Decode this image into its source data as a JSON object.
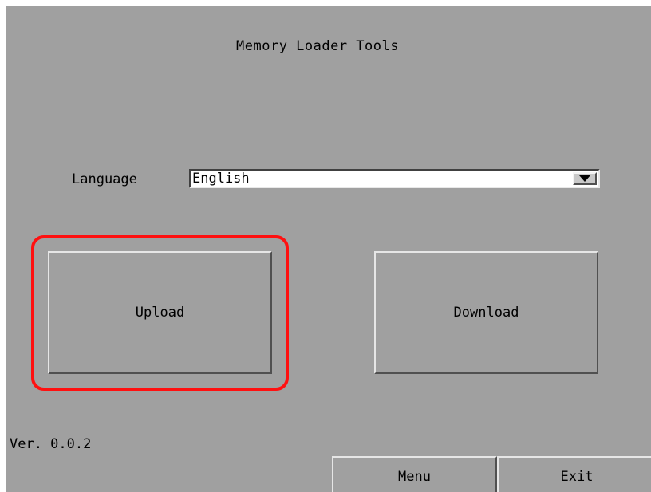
{
  "screen": {
    "title": "Memory Loader Tools",
    "background_color": "#a0a0a0"
  },
  "language": {
    "label": "Language",
    "selected": "English",
    "arrow_icon": "triangle-down-icon"
  },
  "actions": {
    "upload_label": "Upload",
    "download_label": "Download"
  },
  "highlight": {
    "target": "upload-button",
    "color": "#ff1010"
  },
  "footer": {
    "version": "Ver. 0.0.2",
    "menu_label": "Menu",
    "exit_label": "Exit"
  }
}
